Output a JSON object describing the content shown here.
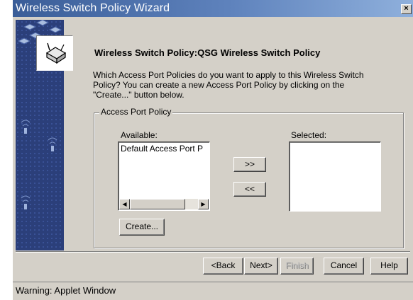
{
  "window": {
    "title": "Wireless Switch Policy Wizard",
    "close_glyph": "×"
  },
  "heading": "Wireless Switch Policy:QSG Wireless Switch Policy",
  "description_lines": [
    "Which Access Port Policies do you want to apply to this Wireless Switch",
    "Policy?  You can create a new Access Port Policy by clicking on the",
    "\"Create...\" button below."
  ],
  "group": {
    "legend": "Access Port Policy",
    "available_label": "Available:",
    "selected_label": "Selected:",
    "available_items": [
      "Default Access Port P"
    ],
    "selected_items": [],
    "add_label": ">>",
    "remove_label": "<<",
    "create_label": "Create..."
  },
  "nav": {
    "back_label": "<Back",
    "next_label": "Next>",
    "finish_label": "Finish",
    "cancel_label": "Cancel",
    "help_label": "Help"
  },
  "status": {
    "text": "Warning: Applet Window"
  },
  "colors": {
    "title_bar": "#3a5d98",
    "side_panel": "#2b3f7a",
    "dialog_bg": "#d4d0c8"
  }
}
